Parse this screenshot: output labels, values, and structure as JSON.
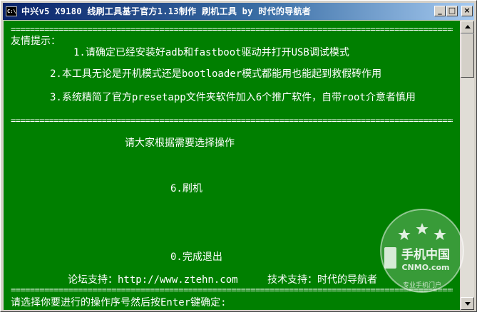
{
  "window": {
    "icon_label": "C:\\",
    "title": "中兴v5 X9180 线刷工具基于官方1.13制作 刷机工具 by 时代的导航者"
  },
  "console": {
    "separator": "==================================================================================================",
    "heading": "友情提示：",
    "tip1": "1.请确定已经安装好adb和fastboot驱动并打开USB调试模式",
    "tip2": "2.本工具无论是开机模式还是bootloader模式都能用也能起到救假砖作用",
    "tip3": "3.系统精简了官方presetapp文件夹软件加入6个推广软件，自带root介意者慎用",
    "prompt_choose": "请大家根据需要选择操作",
    "option_flash": "6.刷机",
    "option_exit": "0.完成退出",
    "forum_support": "论坛支持：http://www.ztehn.com",
    "tech_support": "技术支持：时代的导航者",
    "input_prompt": "请选择你要进行的操作序号然后按Enter键确定:"
  },
  "watermark": {
    "brand": "手机中国",
    "domain": "CNMO.com",
    "slogan": "专业手机门户"
  },
  "colors": {
    "console_bg": "#007f00",
    "console_text": "#ffffff",
    "titlebar_start": "#0a246a",
    "titlebar_end": "#a6caf0"
  },
  "icons": {
    "minimize": "minimize-icon",
    "maximize": "maximize-icon",
    "close": "close-icon"
  }
}
